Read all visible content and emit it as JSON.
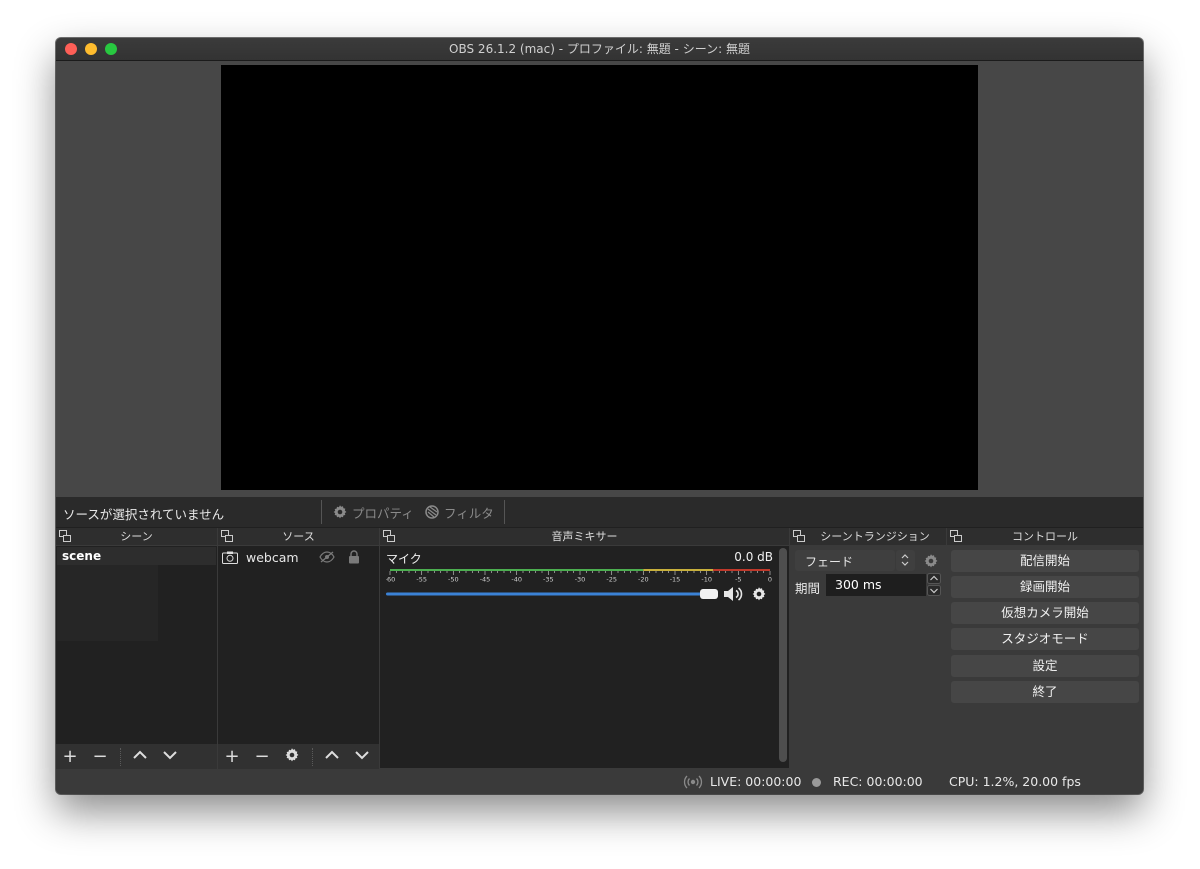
{
  "window": {
    "title": "OBS 26.1.2 (mac) - プロファイル: 無題 - シーン: 無題"
  },
  "source_toolbar": {
    "no_selection": "ソースが選択されていません",
    "properties_label": "プロパティ",
    "filters_label": "フィルタ"
  },
  "scenes": {
    "title": "シーン",
    "items": [
      "scene"
    ]
  },
  "sources": {
    "title": "ソース",
    "items": [
      {
        "label": "webcam",
        "icon": "camera-icon",
        "visible": false,
        "locked": true
      }
    ]
  },
  "mixer": {
    "title": "音声ミキサー",
    "channel": {
      "name": "マイク",
      "db": "0.0 dB",
      "scale": [
        "-60",
        "-55",
        "-50",
        "-45",
        "-40",
        "-35",
        "-30",
        "-25",
        "-20",
        "-15",
        "-10",
        "-5",
        "0"
      ],
      "volume_fraction": 1.0
    }
  },
  "transitions": {
    "title": "シーントランジション",
    "selected": "フェード",
    "duration_label": "期間",
    "duration_value": "300 ms"
  },
  "controls": {
    "title": "コントロール",
    "buttons": [
      "配信開始",
      "録画開始",
      "仮想カメラ開始",
      "スタジオモード",
      "設定",
      "終了"
    ]
  },
  "status": {
    "live": "LIVE: 00:00:00",
    "rec": "REC: 00:00:00",
    "cpu": "CPU: 1.2%, 20.00 fps"
  },
  "colors": {
    "accent": "#3b82d6",
    "meter_green": "#4caf50",
    "meter_yellow": "#c8b03c",
    "meter_red": "#c0392b"
  }
}
